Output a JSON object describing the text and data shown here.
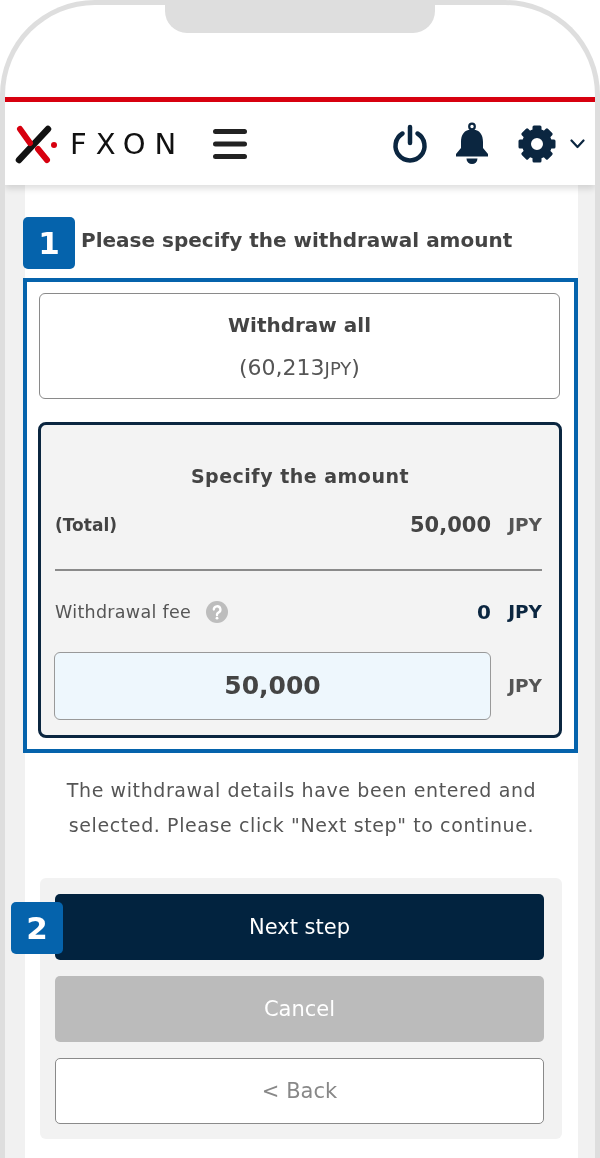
{
  "header": {
    "logo_text": "FXON"
  },
  "step_1": {
    "badge": "1",
    "title": "Please specify the withdrawal amount"
  },
  "options": [
    {
      "kind": "all",
      "selected": false,
      "title": "Withdraw all",
      "amount": "(60,213",
      "unit": "JPY",
      "closing": ")"
    },
    {
      "kind": "specify",
      "selected": true,
      "title": "Specify the amount",
      "total_label": "(Total)",
      "total_value": "50,000",
      "total_unit": "JPY",
      "fee_label": "Withdrawal fee",
      "fee_value": "0",
      "fee_unit": "JPY",
      "input_value": "50,000",
      "input_unit": "JPY"
    }
  ],
  "note": "The withdrawal details have been entered and selected. Please click \"Next step\" to continue.",
  "step_2": {
    "badge": "2"
  },
  "buttons": [
    {
      "kind": "next",
      "label": "Next step"
    },
    {
      "kind": "cancel",
      "label": "Cancel"
    },
    {
      "kind": "back",
      "label": "< Back"
    }
  ]
}
